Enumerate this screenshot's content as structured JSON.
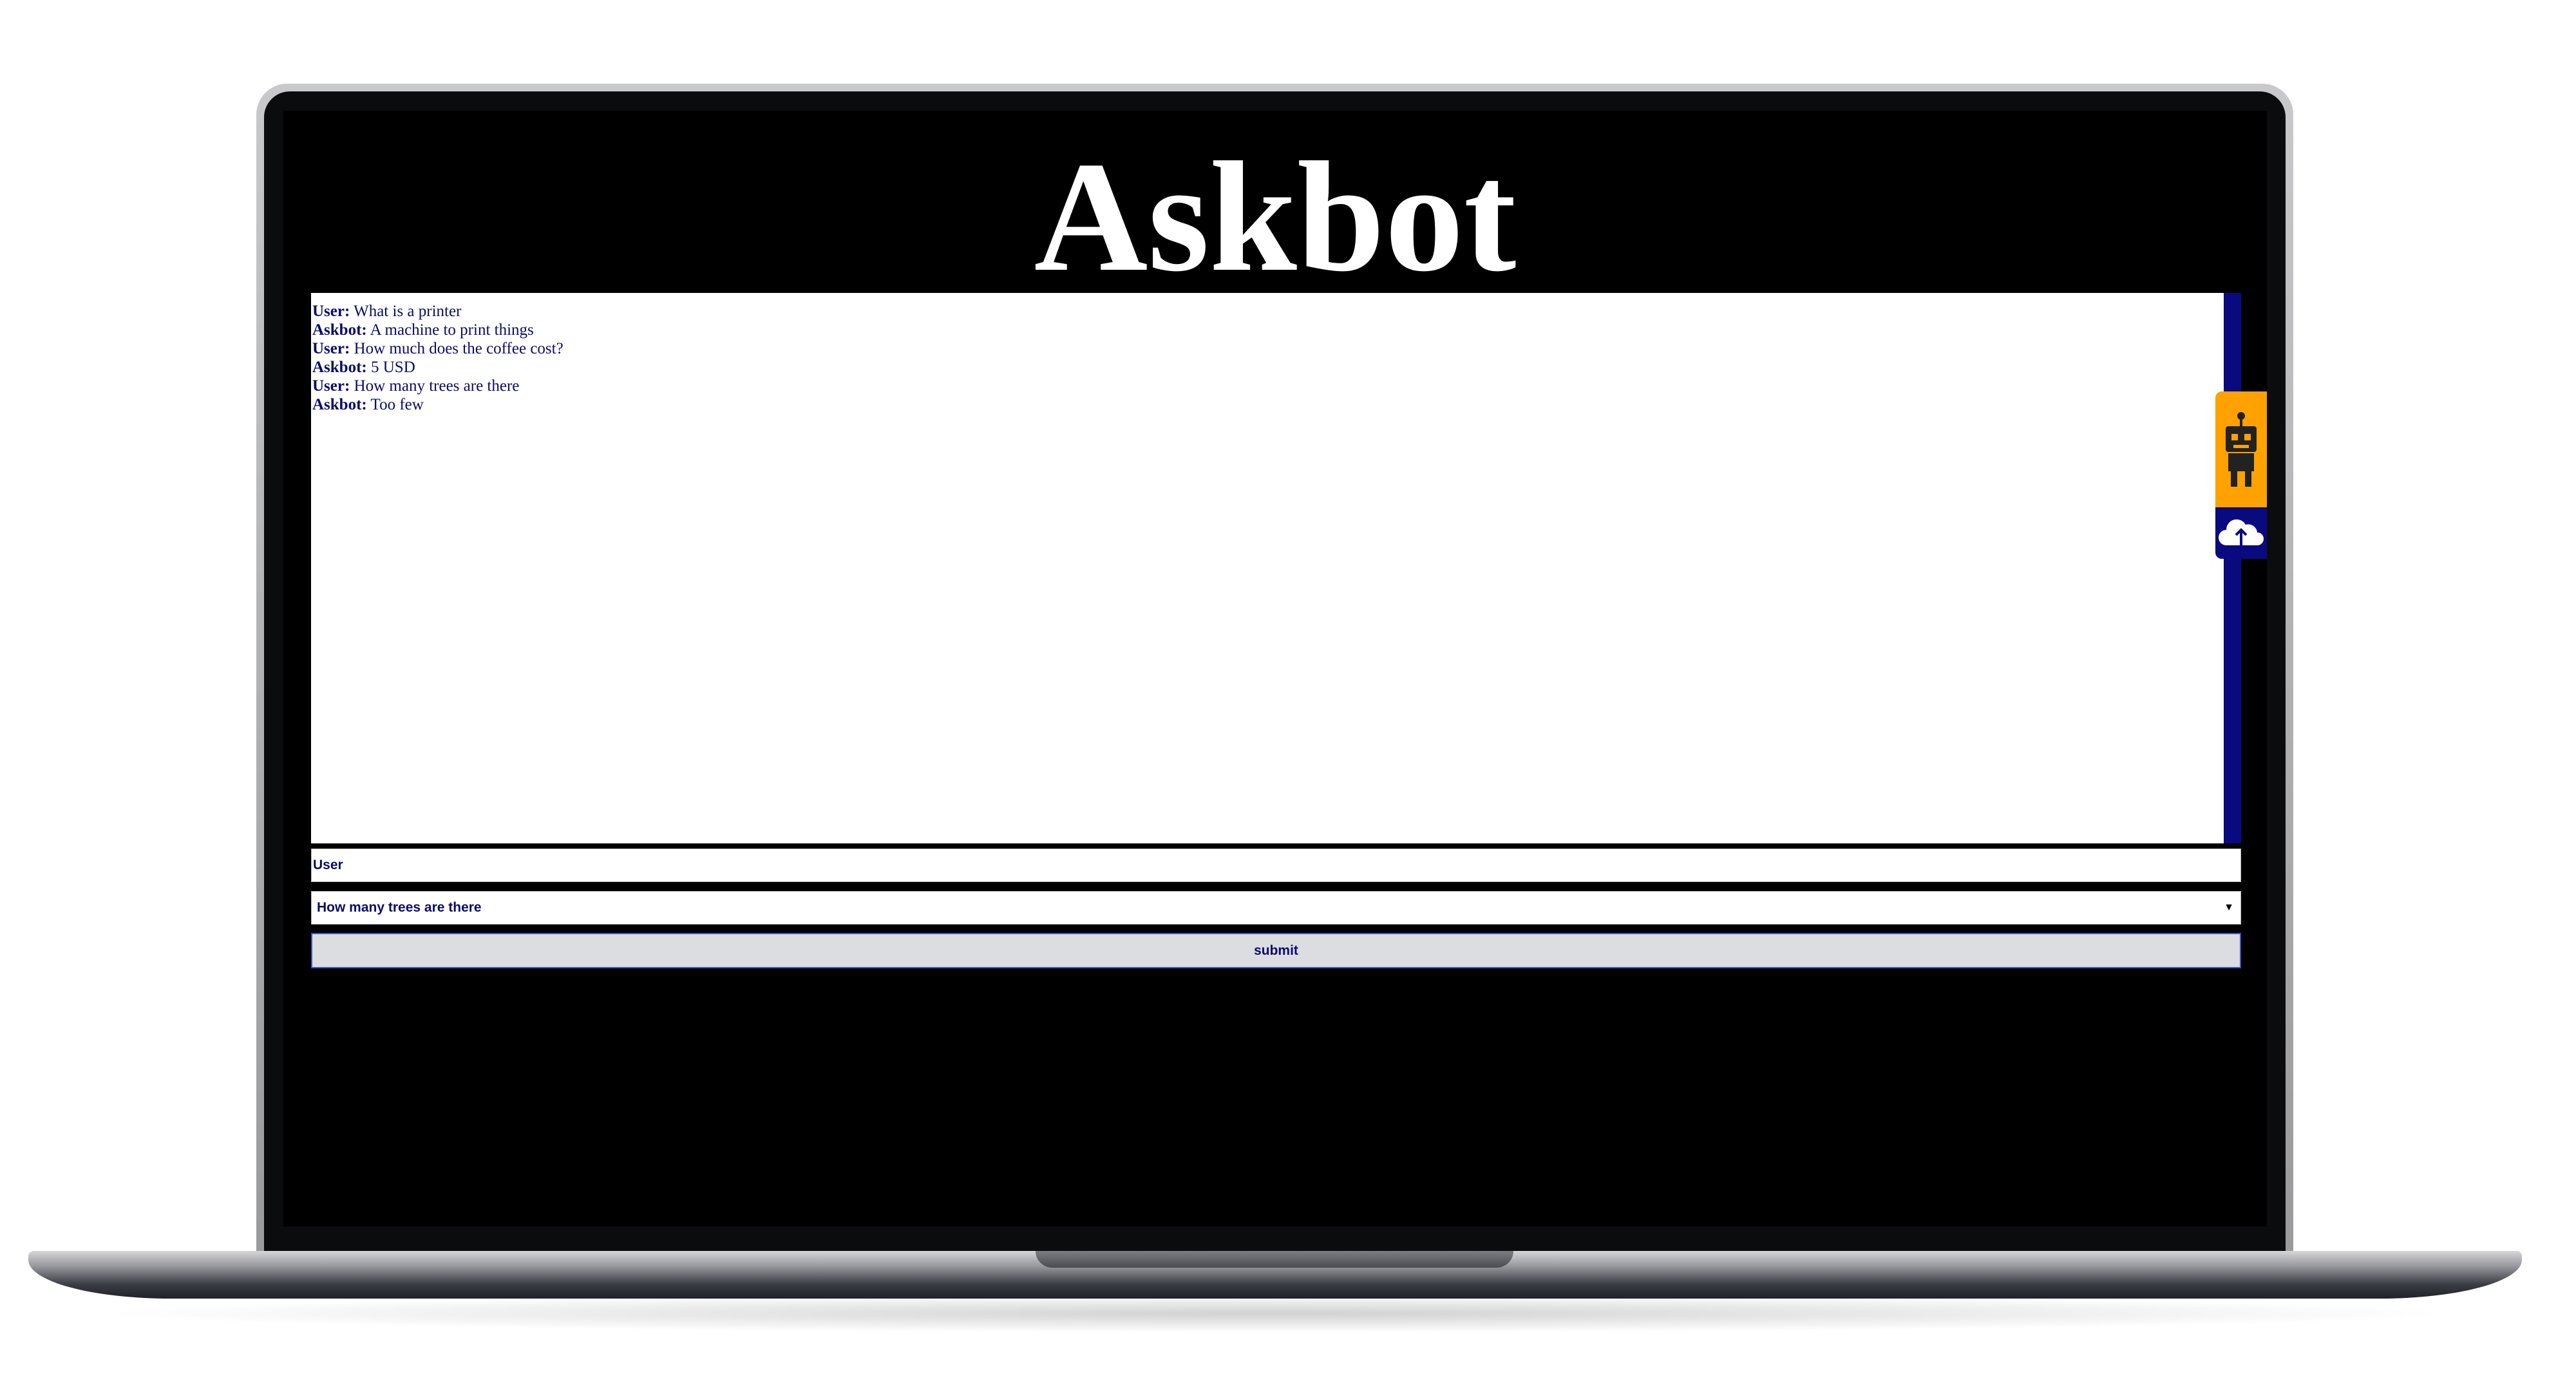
{
  "app": {
    "title": "Askbot"
  },
  "chat": {
    "messages": [
      {
        "speaker": "User:",
        "text": " What is a printer"
      },
      {
        "speaker": "Askbot:",
        "text": " A machine to print things"
      },
      {
        "speaker": "User:",
        "text": " How much does the coffee cost?"
      },
      {
        "speaker": "Askbot:",
        "text": " 5 USD"
      },
      {
        "speaker": "User:",
        "text": " How many trees are there"
      },
      {
        "speaker": "Askbot:",
        "text": " Too few"
      }
    ]
  },
  "form": {
    "name_value": "User",
    "question_selected": "How many trees are there",
    "submit_label": "submit"
  },
  "icons": {
    "widget_top": "robot-icon",
    "widget_bottom": "cloud-upload-icon",
    "select_arrow": "dropdown-arrow-icon"
  },
  "colors": {
    "screen_background": "#000000",
    "text_navy": "#0b0b6b",
    "scroll_track": "#0a0a80",
    "widget_orange": "#ffa200",
    "button_border": "#3a55c8"
  }
}
